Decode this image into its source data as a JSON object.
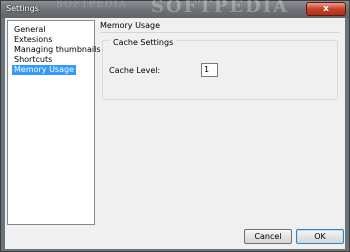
{
  "window": {
    "title": "Settings",
    "watermark": "SOFTPEDIA",
    "watermark_small": "SOFTPEDIA",
    "close_glyph": "x"
  },
  "tree": {
    "items": [
      {
        "label": "General",
        "selected": false
      },
      {
        "label": "Extesions",
        "selected": false
      },
      {
        "label": "Managing thumbnails",
        "selected": false
      },
      {
        "label": "Shortcuts",
        "selected": false
      },
      {
        "label": "Memory Usage",
        "selected": true
      }
    ]
  },
  "panel": {
    "title": "Memory Usage",
    "group_label": "Cache Settings",
    "cache_level_label": "Cache Level:",
    "cache_level_value": "1"
  },
  "buttons": {
    "cancel": "Cancel",
    "ok": "OK"
  }
}
